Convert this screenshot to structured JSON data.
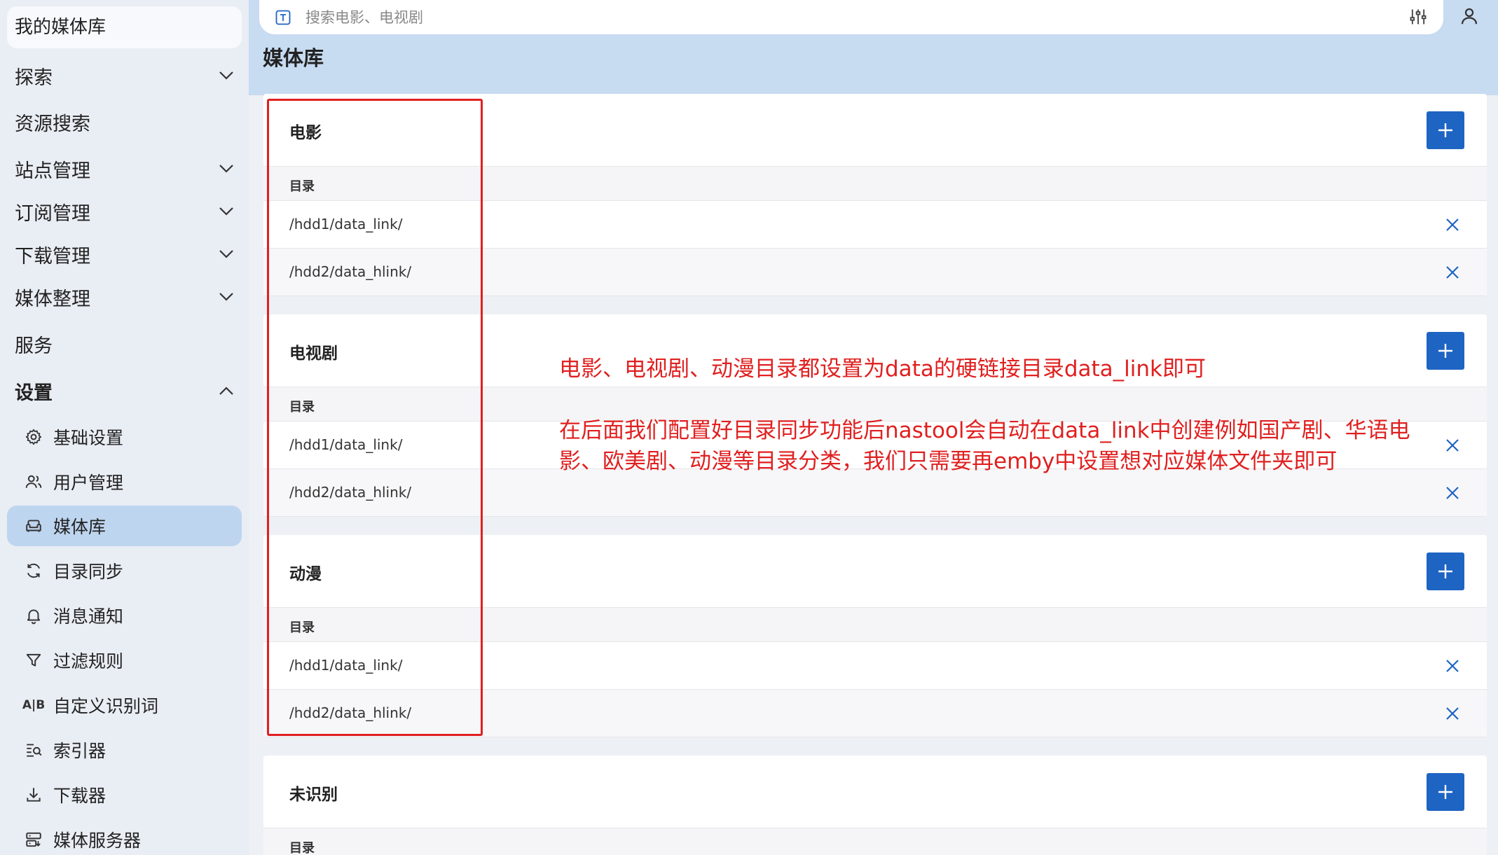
{
  "sidebar": {
    "brand": "我的媒体库",
    "items": [
      {
        "label": "探索",
        "chevron": "down"
      },
      {
        "label": "资源搜索",
        "chevron": "none"
      },
      {
        "label": "站点管理",
        "chevron": "down"
      },
      {
        "label": "订阅管理",
        "chevron": "down"
      },
      {
        "label": "下载管理",
        "chevron": "down"
      },
      {
        "label": "媒体整理",
        "chevron": "down"
      },
      {
        "label": "服务",
        "chevron": "none"
      },
      {
        "label": "设置",
        "chevron": "up"
      }
    ],
    "settings_children": [
      {
        "label": "基础设置",
        "icon": "gear-icon"
      },
      {
        "label": "用户管理",
        "icon": "users-icon"
      },
      {
        "label": "媒体库",
        "icon": "sofa-icon",
        "active": true
      },
      {
        "label": "目录同步",
        "icon": "sync-icon"
      },
      {
        "label": "消息通知",
        "icon": "bell-icon"
      },
      {
        "label": "过滤规则",
        "icon": "filter-icon"
      },
      {
        "label": "自定义识别词",
        "icon": "ab-icon",
        "icon_text": "A|B"
      },
      {
        "label": "索引器",
        "icon": "search-list-icon"
      },
      {
        "label": "下载器",
        "icon": "download-icon"
      },
      {
        "label": "媒体服务器",
        "icon": "server-icon"
      }
    ]
  },
  "search": {
    "placeholder": "搜索电影、电视剧"
  },
  "page_title": "媒体库",
  "sections": [
    {
      "title": "电影",
      "column": "目录",
      "rows": [
        "/hdd1/data_link/",
        "/hdd2/data_hlink/"
      ]
    },
    {
      "title": "电视剧",
      "column": "目录",
      "rows": [
        "/hdd1/data_link/",
        "/hdd2/data_hlink/"
      ]
    },
    {
      "title": "动漫",
      "column": "目录",
      "rows": [
        "/hdd1/data_link/",
        "/hdd2/data_hlink/"
      ]
    },
    {
      "title": "未识别",
      "column": "目录",
      "rows": []
    }
  ],
  "annotations": {
    "note1": "电影、电视剧、动漫目录都设置为data的硬链接目录data_link即可",
    "note2": "在后面我们配置好目录同步功能后nastool会自动在data_link中创建例如国产剧、华语电影、欧美剧、动漫等目录分类，我们只需要再emby中设置想对应媒体文件夹即可"
  },
  "colors": {
    "accent": "#1e64c3",
    "annotation": "#e02020",
    "sidebar_bg": "#e9edf4",
    "active_item": "#bed5ef",
    "header_bg": "#c7dbf1"
  }
}
